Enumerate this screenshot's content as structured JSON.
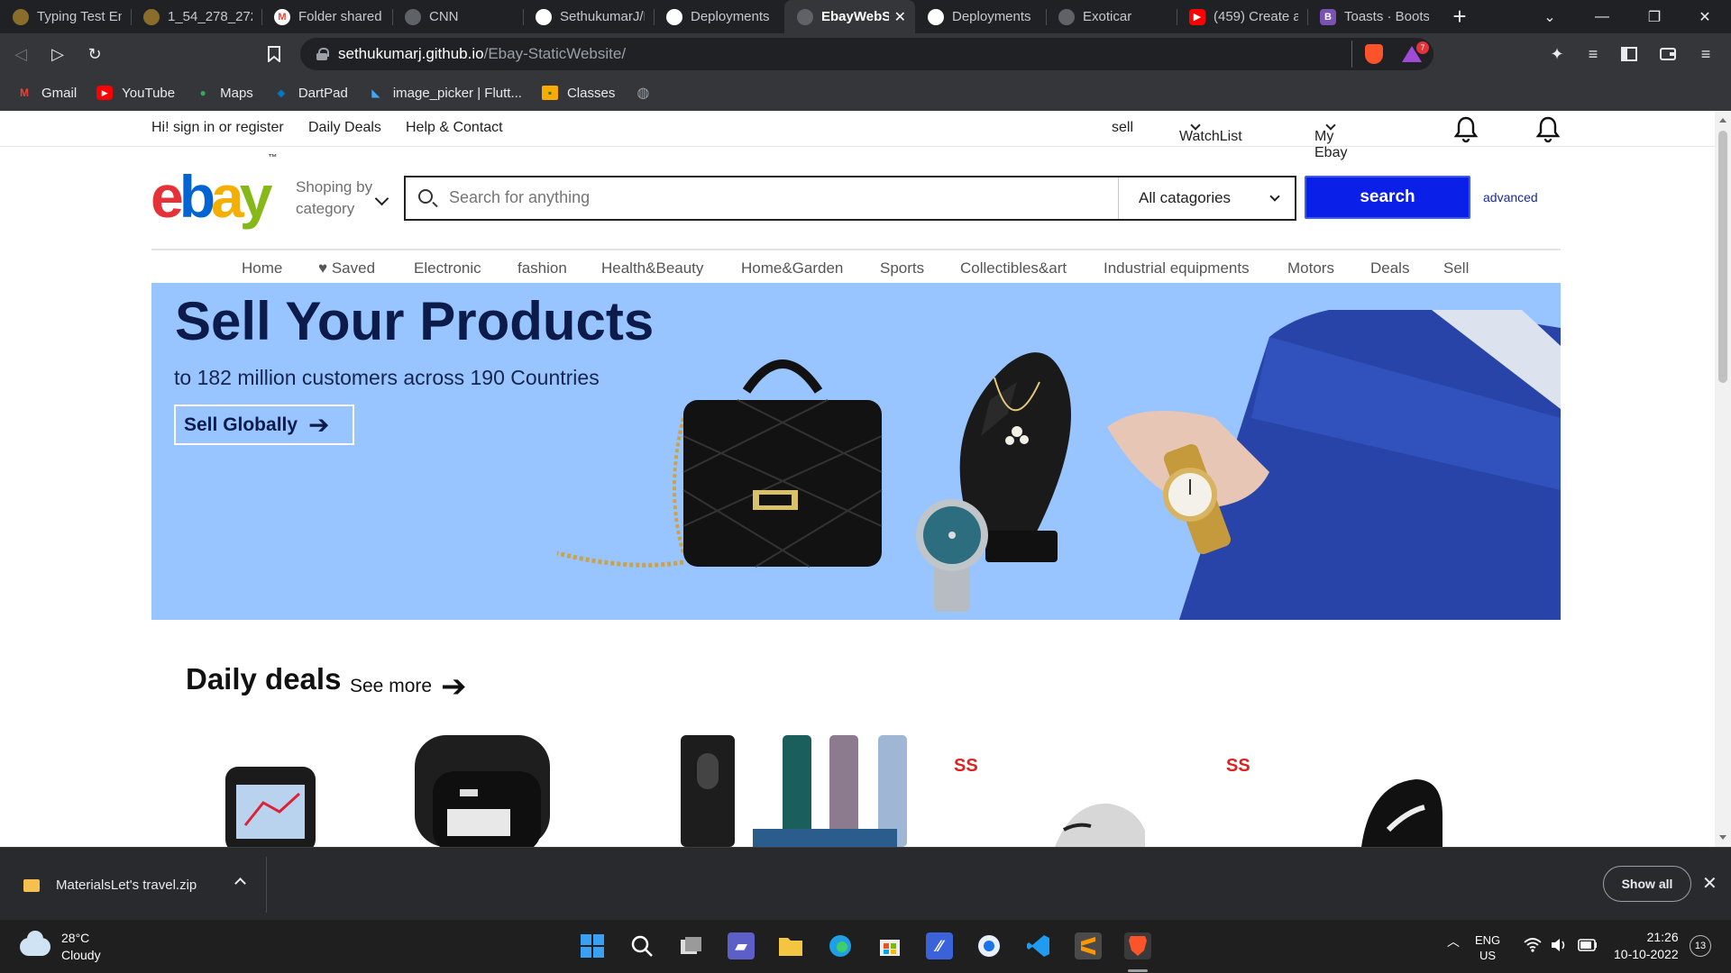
{
  "browser": {
    "tabs": [
      {
        "label": "Typing Test En",
        "icon_color": "#8a6d2b"
      },
      {
        "label": "1_54_278_272",
        "icon_color": "#8a6d2b"
      },
      {
        "label": "Folder shared",
        "icon_color": "#ea4335"
      },
      {
        "label": "CNN",
        "icon_color": "#5f6368"
      },
      {
        "label": "SethukumarJ/E",
        "icon_color": "#ffffff"
      },
      {
        "label": "Deployments",
        "icon_color": "#ffffff"
      },
      {
        "label": "EbayWebS",
        "icon_color": "#5f6368",
        "active": true
      },
      {
        "label": "Deployments",
        "icon_color": "#ffffff"
      },
      {
        "label": "Exoticar",
        "icon_color": "#5f6368"
      },
      {
        "label": "(459) Create a",
        "icon_color": "#ff0000"
      },
      {
        "label": "Toasts · Boots",
        "icon_color": "#7952b3"
      }
    ],
    "url_host": "sethukumarj.github.io",
    "url_path": "/Ebay-StaticWebsite/",
    "brave_shields_count": "7",
    "bookmarks": [
      {
        "label": "Gmail",
        "icon": "gmail-icon",
        "color": "#ea4335"
      },
      {
        "label": "YouTube",
        "icon": "youtube-icon",
        "color": "#ff0000"
      },
      {
        "label": "Maps",
        "icon": "maps-icon",
        "color": "#34a853"
      },
      {
        "label": "DartPad",
        "icon": "dartpad-icon",
        "color": "#0175c2"
      },
      {
        "label": "image_picker | Flutt...",
        "icon": "flutter-icon",
        "color": "#42a5f5"
      },
      {
        "label": "Classes",
        "icon": "classroom-icon",
        "color": "#f9ab00"
      },
      {
        "label": "",
        "icon": "globe-icon",
        "color": "#9aa0a6"
      }
    ]
  },
  "page": {
    "topnav": {
      "signin": "Hi! sign in or register",
      "daily_deals": "Daily Deals",
      "help": "Help & Contact",
      "sell": "sell",
      "watchlist": "WatchList",
      "myebay": "My Ebay"
    },
    "logo": {
      "e": "e",
      "b": "b",
      "a": "a",
      "y": "y",
      "tm": "™"
    },
    "shop_by": "Shoping by category",
    "search": {
      "placeholder": "Search for anything",
      "category": "All catagories",
      "button": "search",
      "advanced": "advanced"
    },
    "categories": [
      "Home",
      "♥ Saved",
      "Electronic",
      "fashion",
      "Health&Beauty",
      "Home&Garden",
      "Sports",
      "Collectibles&art",
      "Industrial equipments",
      "Motors",
      "Deals",
      "Sell"
    ],
    "hero": {
      "title": "Sell Your Products",
      "subtitle": "to 182 million customers across 190 Countries",
      "button": "Sell Globally",
      "arrow": "➔",
      "bg_color": "#98c5ff"
    },
    "deals": {
      "title": "Daily deals",
      "see_more": "See more",
      "arrow": "➔",
      "brand_mark": "SS"
    }
  },
  "download_shelf": {
    "file_name": "MaterialsLet's travel.zip",
    "show_all": "Show all"
  },
  "taskbar": {
    "temperature": "28°C",
    "condition": "Cloudy",
    "language": "ENG",
    "region": "US",
    "time": "21:26",
    "date": "10-10-2022",
    "notification_count": "13"
  }
}
